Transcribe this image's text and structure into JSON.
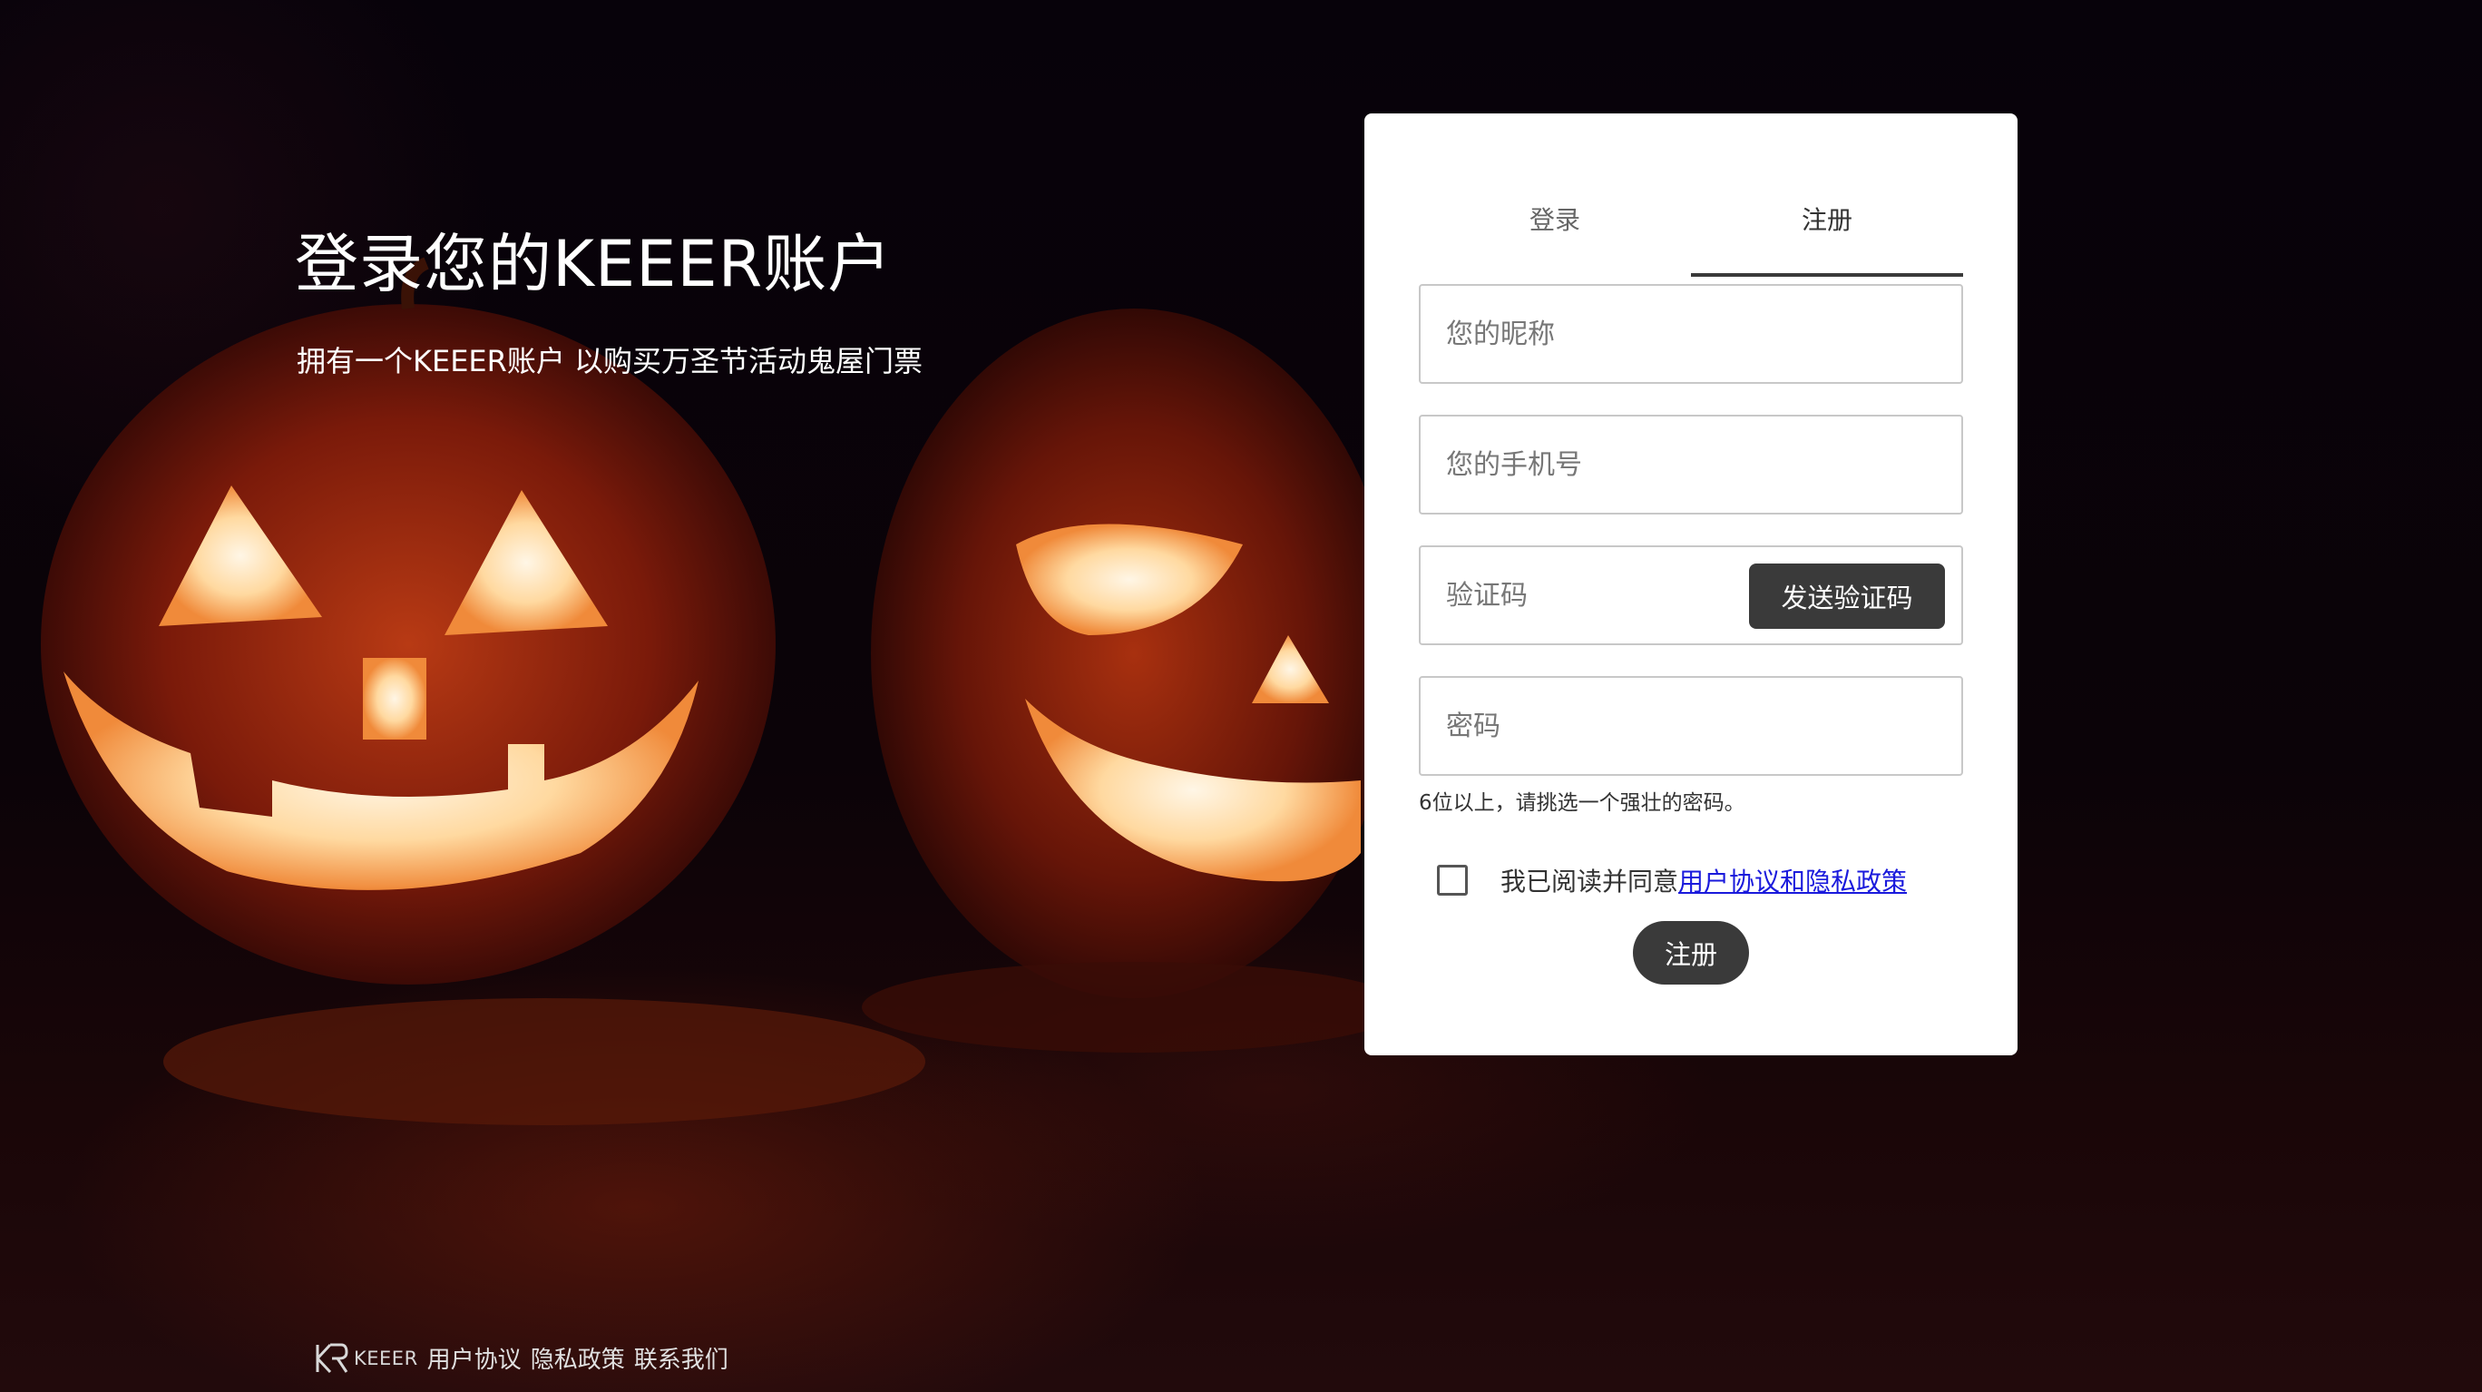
{
  "hero": {
    "title": "登录您的KEEER账户",
    "subtitle": "拥有一个KEEER账户 以购买万圣节活动鬼屋门票"
  },
  "tabs": [
    {
      "label": "登录",
      "active": false
    },
    {
      "label": "注册",
      "active": true
    }
  ],
  "form": {
    "nickname_placeholder": "您的昵称",
    "phone_placeholder": "您的手机号",
    "code_placeholder": "验证码",
    "send_code_label": "发送验证码",
    "password_placeholder": "密码",
    "password_hint": "6位以上，请挑选一个强壮的密码。",
    "agree_text": "我已阅读并同意",
    "agree_link": "用户协议和隐私政策",
    "agree_checked": false,
    "submit_label": "注册"
  },
  "footer": {
    "brand": "KEEER",
    "links": [
      "用户协议",
      "隐私政策",
      "联系我们"
    ]
  },
  "colors": {
    "accent": "#3a3a3a",
    "link": "#1a1adc",
    "card": "#ffffff"
  },
  "background_image": "halloween-jack-o-lanterns-photo"
}
